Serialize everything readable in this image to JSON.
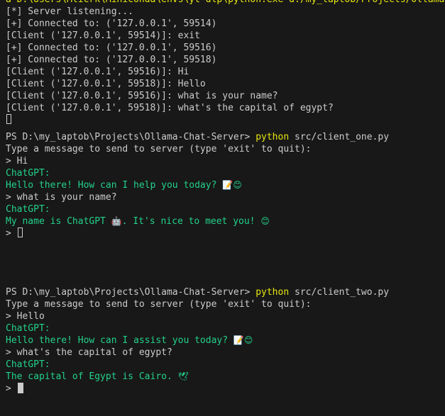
{
  "server_pane": {
    "cmd_partial": "a D:\\Users\\Mlicrk\\Miniconda\\envs\\yt-dlp\\python.exe d:/my_laptob/Projects/Ollama-Chat-Server",
    "lines": [
      "[*] Server listening...",
      "[+] Connected to: ('127.0.0.1', 59514)",
      "[Client ('127.0.0.1', 59514)]: exit",
      "[+] Connected to: ('127.0.0.1', 59516)",
      "[+] Connected to: ('127.0.0.1', 59518)",
      "[Client ('127.0.0.1', 59516)]: Hi",
      "[Client ('127.0.0.1', 59518)]: Hello",
      "[Client ('127.0.0.1', 59516)]: what is your name?",
      "[Client ('127.0.0.1', 59518)]: what's the capital of egypt?"
    ]
  },
  "client_one": {
    "prompt": "PS D:\\my_laptob\\Projects\\Ollama-Chat-Server> ",
    "command": "python",
    "args": " src/client_one.py",
    "intro": "Type a message to send to server (type 'exit' to quit):",
    "user1": "> Hi",
    "bot_label1": "ChatGPT:",
    "bot_msg1": "Hello there! How can I help you today? ",
    "bot_emoji1": "📝😊",
    "user2": "> what is your name?",
    "bot_label2": "ChatGPT:",
    "bot_msg2": "My name is ChatGPT ",
    "bot_emoji2a": "🤖",
    "bot_msg2b": ". It's nice to meet you! ",
    "bot_emoji2b": "😊",
    "input_prompt": "> "
  },
  "client_two": {
    "prompt": "PS D:\\my_laptob\\Projects\\Ollama-Chat-Server> ",
    "command": "python",
    "args": " src/client_two.py",
    "intro": "Type a message to send to server (type 'exit' to quit):",
    "user1": "> Hello",
    "bot_label1": "ChatGPT:",
    "bot_msg1": "Hello there! How can I assist you today? ",
    "bot_emoji1": "📝😊",
    "user2": "> what's the capital of egypt?",
    "bot_label2": "ChatGPT:",
    "bot_msg2": "The capital of Egypt is Cairo. ",
    "bot_emoji2": "🕊",
    "input_prompt": "> "
  },
  "colors": {
    "bg": "#181818",
    "text": "#cccccc",
    "bot": "#23d18b",
    "command": "#e5e510"
  }
}
